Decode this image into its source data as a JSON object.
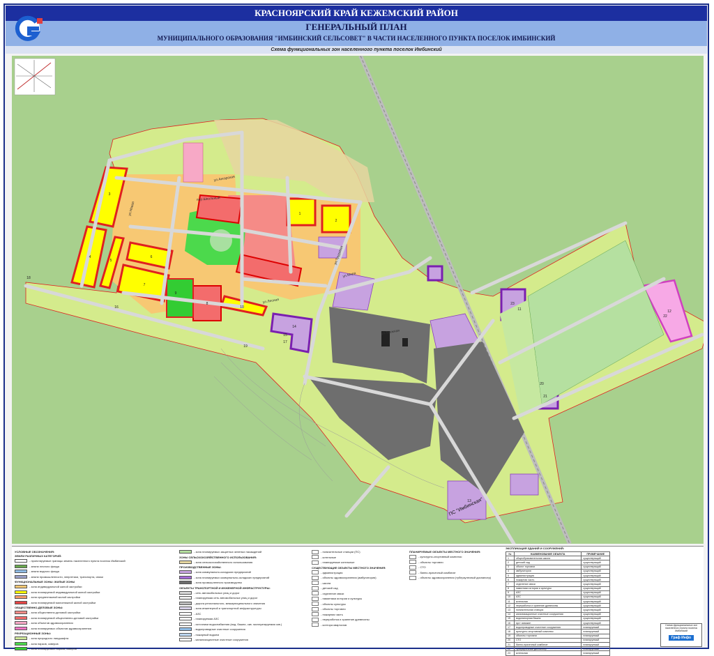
{
  "header": {
    "region": "КРАСНОЯРСКИЙ КРАЙ КЕЖЕМСКИЙ РАЙОН",
    "title": "ГЕНЕРАЛЬНЫЙ ПЛАН",
    "subtitle": "МУНИЦИПАЛЬНОГО ОБРАЗОВАНИЯ \"ИМБИНСКИЙ СЕЛЬСОВЕТ\" В ЧАСТИ НАСЕЛЕННОГО ПУНКТА ПОСЕЛОК ИМБИНСКИЙ",
    "scheme": "Схема функциональных зон населенного пункта поселок Имбинский"
  },
  "map": {
    "streets": [
      "ул.Ангарская",
      "пер.Школьный",
      "ул.Мира",
      "ул.Новая",
      "ул.Таежная",
      "ул.Трудовая",
      "ул.Лесная"
    ],
    "substation_label": "ПС \"Имбинская\"",
    "zone_numbers": [
      "1",
      "2",
      "3",
      "4",
      "5",
      "6",
      "7",
      "8",
      "9",
      "10",
      "11",
      "12",
      "13",
      "14",
      "15",
      "16",
      "17",
      "18",
      "19",
      "20",
      "21",
      "22",
      "23"
    ],
    "colors": {
      "background": "#a8d08d",
      "settlement_boundary": "#d4eb8c",
      "residential_individual": "#f7c873",
      "residential_planned": "#ffff00",
      "public_business": "#f58b87",
      "industrial": "#c7a2e0",
      "industrial_planned": "#8a3fc0",
      "recreation": "#4cd94c",
      "road": "#d8d8d8",
      "quarry": "#6e6e6e",
      "railway": "#9a9a9a",
      "planned_boundary_red": "#e02020"
    }
  },
  "legend": {
    "title": "УСЛОВНЫЕ ОБОЗНАЧЕНИЯ:",
    "col1": [
      {
        "type": "head",
        "text": "ЗЕМЛИ РАЗЛИЧНЫХ КАТЕГОРИЙ:"
      },
      {
        "type": "row",
        "text": "- проектируемые границы земель населенного пункта поселок Имбинский",
        "color": "#ffffff"
      },
      {
        "type": "row",
        "text": "- земли лесного фонда",
        "color": "#6aa84f"
      },
      {
        "type": "row",
        "text": "- земли водного фонда",
        "color": "#8fbce6"
      },
      {
        "type": "row",
        "text": "- земли промышленности, энергетики, транспорта, связи",
        "color": "#9aa0c8"
      },
      {
        "type": "head",
        "text": "ФУНКЦИОНАЛЬНЫЕ ЗОНЫ: ЖИЛЫЕ ЗОНЫ"
      },
      {
        "type": "row",
        "text": "- зона индивидуальной жилой застройки",
        "color": "#f7c873"
      },
      {
        "type": "row",
        "text": "- зона планируемой индивидуальной жилой застройки",
        "color": "#ffff00"
      },
      {
        "type": "row",
        "text": "- зона среднеэтажной жилой застройки",
        "color": "#f49a6a"
      },
      {
        "type": "row",
        "text": "- зона планируемой малоэтажной жилой застройки",
        "color": "#e54545"
      },
      {
        "type": "head",
        "text": "ОБЩЕСТВЕННО-ДЕЛОВЫЕ ЗОНЫ:"
      },
      {
        "type": "row",
        "text": "- зона общественно-деловой застройки",
        "color": "#f58b87"
      },
      {
        "type": "row",
        "text": "- зона планируемой общественно-деловой застройки",
        "color": "#f36c6c"
      },
      {
        "type": "row",
        "text": "- зона объектов здравоохранения",
        "color": "#f7a9c6"
      },
      {
        "type": "row",
        "text": "- зона планируемых объектов здравоохранения",
        "color": "#f076c3"
      },
      {
        "type": "head",
        "text": "РЕКРЕАЦИОННЫЕ ЗОНЫ:"
      },
      {
        "type": "row",
        "text": "- зона природного ландшафта",
        "color": "#cfe89a"
      },
      {
        "type": "row",
        "text": "- зона парков, скверов",
        "color": "#4cd94c"
      },
      {
        "type": "row",
        "text": "- зона планируемых парков, скверов",
        "color": "#33cc33"
      }
    ],
    "col2": [
      {
        "type": "row",
        "text": "- зона планируемых защитных зеленых насаждений",
        "color": "#b5e0a0"
      },
      {
        "type": "head",
        "text": "ЗОНЫ СЕЛЬСКОХОЗЯЙСТВЕННОГО ИСПОЛЬЗОВАНИЯ:"
      },
      {
        "type": "row",
        "text": "- зона сельскохозяйственного использования",
        "color": "#e6d6a0"
      },
      {
        "type": "head",
        "text": "ПРОИЗВОДСТВЕННЫЕ ЗОНЫ:"
      },
      {
        "type": "row",
        "text": "- зона коммунально-складских предприятий",
        "color": "#c7a2e0"
      },
      {
        "type": "row",
        "text": "- зона планируемых коммунально-складских предприятий",
        "color": "#a36ad6"
      },
      {
        "type": "row",
        "text": "- зона промышленного производства",
        "color": "#6e6e6e"
      },
      {
        "type": "head",
        "text": "ОБЪЕКТЫ ТРАНСПОРТНОЙ И ИНЖЕНЕРНОЙ ИНФРАСТРУКТУРЫ:"
      },
      {
        "type": "row",
        "text": "- сеть автомобильных улиц и дорог",
        "color": "#d8d8d8"
      },
      {
        "type": "row",
        "text": "- планируемая сеть автомобильных улиц и дорог",
        "color": "#eeeeee"
      },
      {
        "type": "row",
        "text": "- дорога регионального, межмуниципального значения",
        "color": "#bbbbbb"
      },
      {
        "type": "row",
        "text": "- зона инженерной и транспортной инфраструктуры",
        "color": "#d9d2e9"
      },
      {
        "type": "row",
        "text": "- АЗС",
        "color": "#ffffff"
      },
      {
        "type": "row",
        "text": "- планируемая АЗС",
        "color": "#ffffff"
      },
      {
        "type": "row",
        "text": "- источники водоснабжения (вод. башни, скв. эксплуатируемая скв.)",
        "color": "#ffffff"
      },
      {
        "type": "row",
        "text": "- водопроводные очистные сооружения",
        "color": "#8fbce6"
      },
      {
        "type": "row",
        "text": "- пожарный водоем",
        "color": "#bcd6f0"
      },
      {
        "type": "row",
        "text": "- канализационные очистные сооружения",
        "color": "#ffffff"
      }
    ],
    "col3_head": "СУЩЕСТВУЮЩИЕ ОБЪЕКТЫ МЕСТНОГО ЗНАЧЕНИЯ:",
    "col3": [
      "- понизительные станции (ПС)",
      "- котельные",
      "- планируемые котельные",
      "- администрация",
      "- объекты здравоохранения (амбулатория)",
      "- школа",
      "- детский сад",
      "- отделение связи",
      "- памятники истории и культуры",
      "- объекты культуры",
      "- объекты торговли",
      "- пожарная часть",
      "- переработка и хранение древесины",
      "- контора кварталов"
    ],
    "col4_head": "ПЛАНИРУЕМЫЕ ОБЪЕКТЫ МЕСТНОГО ЗНАЧЕНИЯ:",
    "col4": [
      "- культурно-спортивный комплекс",
      "- объекты торговли",
      "- СТО",
      "- банно-прачечный комбинат",
      "- объекты здравоохранения (туберкулезный диспансер)"
    ],
    "table_title": "ЭКСПЛИКАЦИЯ ЗДАНИЙ И СООРУЖЕНИЙ:",
    "table_headers": [
      "№",
      "НАИМЕНОВАНИЕ ОБЪЕКТА",
      "ПРИМЕЧАНИЕ"
    ],
    "table_rows": [
      [
        "1",
        "общеобразовательная школа",
        "существующий"
      ],
      [
        "2",
        "детский сад",
        "существующий"
      ],
      [
        "3",
        "объект торговли",
        "существующий"
      ],
      [
        "4",
        "амбулатория",
        "существующий"
      ],
      [
        "5",
        "администрация",
        "существующий"
      ],
      [
        "6",
        "пожарная часть",
        "существующий"
      ],
      [
        "7",
        "отделение связи",
        "существующий"
      ],
      [
        "8",
        "памятники истории и культуры",
        "существующий"
      ],
      [
        "9",
        "АЗС",
        "существующий"
      ],
      [
        "10",
        "АЗС",
        "существующий"
      ],
      [
        "11",
        "котельная",
        "существующий"
      ],
      [
        "12",
        "переработка и хранение древесины",
        "существующий"
      ],
      [
        "13",
        "понизительная станция",
        "существующий"
      ],
      [
        "14",
        "канализационные очистные сооружения",
        "существующий"
      ],
      [
        "15",
        "водонапорная башня",
        "существующий"
      ],
      [
        "16",
        "куст скважин",
        "существующий"
      ],
      [
        "17",
        "водопроводные очистные сооружения",
        "планируемый"
      ],
      [
        "18",
        "культурно-спортивный комплекс",
        "планируемый"
      ],
      [
        "19",
        "объекты торговли",
        "планируемый"
      ],
      [
        "20",
        "СТО",
        "планируемый"
      ],
      [
        "21",
        "банно-прачечный комбинат",
        "планируемый"
      ],
      [
        "22",
        "туберкулезный диспансер",
        "планируемый"
      ],
      [
        "23",
        "котельная",
        "планируемый"
      ]
    ],
    "stamp_text": "Схема функциональных зон населенного пункта поселок Имбинский",
    "stamp_brand": "Граф Инфо"
  }
}
